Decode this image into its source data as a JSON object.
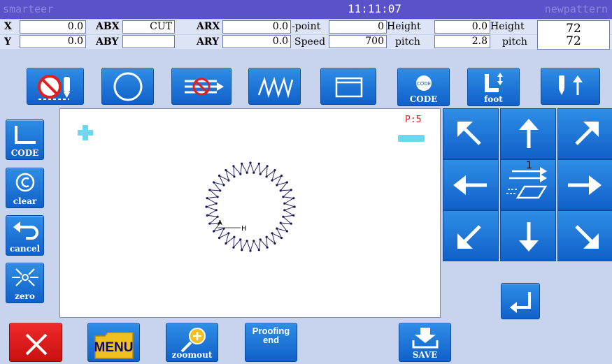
{
  "title_bar": {
    "app_name": "smarteer",
    "time": "11:11:07",
    "pattern_name": "newpattern"
  },
  "readout": {
    "row1": {
      "x_label": "X",
      "x_value": "0.0",
      "abx_label": "ABX",
      "abx_value": "CUT",
      "arx_label": "ARX",
      "arx_value": "0.0",
      "point_label": "-point",
      "point_value": "0",
      "height_label": "Height",
      "height_value": "0.0",
      "height2_label": "Height",
      "height2_value": "72"
    },
    "row2": {
      "y_label": "Y",
      "y_value": "0.0",
      "aby_label": "ABY",
      "aby_value": "",
      "ary_label": "ARY",
      "ary_value": "0.0",
      "speed_label": "Speed",
      "speed_value": "700",
      "pitch_label": "pitch",
      "pitch_value": "2.8",
      "pitch2_label": "pitch",
      "pitch2_value": "72"
    }
  },
  "toolbar": {
    "code_btn_label": "CODE",
    "foot_btn_label": "foot"
  },
  "left_panel": {
    "code_label": "CODE",
    "clear_label": "clear",
    "cancel_label": "cancel",
    "zero_label": "zero"
  },
  "canvas": {
    "page_indicator": "P:5",
    "point_a_label": "A",
    "point_h_label": "H"
  },
  "direction_pad": {
    "center_number": "1"
  },
  "bottom_bar": {
    "menu_label": "MENU",
    "zoomout_label": "zoomout",
    "proofing_label_line1": "Proofing",
    "proofing_label_line2": "end",
    "save_label": "SAVE"
  },
  "colors": {
    "title_bar": "#5a52c8",
    "background": "#c8d4ee",
    "button_blue": "#1f78d8",
    "close_red": "#e02020",
    "menu_yellow": "#f0c020",
    "plus_cyan": "#6fd6f0"
  }
}
